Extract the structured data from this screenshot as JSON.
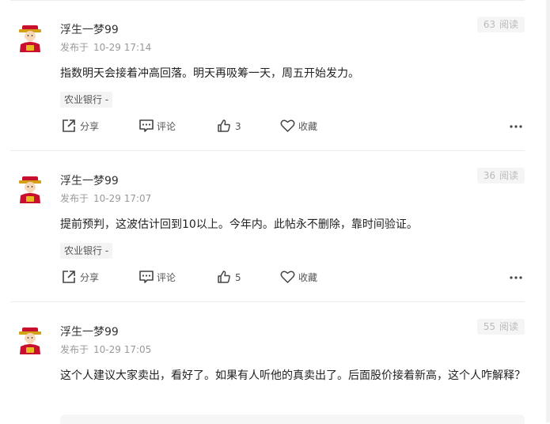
{
  "posts": [
    {
      "author": "浮生一梦99",
      "published_prefix": "发布于",
      "date": "10-29 17:14",
      "views_count": "63",
      "views_label": "阅读",
      "content": "指数明天会接着冲高回落。明天再吸筹一天，周五开始发力。",
      "tag": "农业银行 -",
      "share_label": "分享",
      "comment_label": "评论",
      "like_count": "3",
      "collect_label": "收藏"
    },
    {
      "author": "浮生一梦99",
      "published_prefix": "发布于",
      "date": "10-29 17:07",
      "views_count": "36",
      "views_label": "阅读",
      "content": "提前预判，这波估计回到10以上。今年内。此帖永不删除，靠时间验证。",
      "tag": "农业银行 -",
      "share_label": "分享",
      "comment_label": "评论",
      "like_count": "5",
      "collect_label": "收藏"
    },
    {
      "author": "浮生一梦99",
      "published_prefix": "发布于",
      "date": "10-29 17:05",
      "views_count": "55",
      "views_label": "阅读",
      "content": "这个人建议大家卖出，看好了。如果有人听他的真卖出了。后面股价接着新高，这个人咋解释？"
    }
  ],
  "icons": {
    "avatar": "caishen-avatar-icon",
    "share": "share-icon",
    "comment": "comment-icon",
    "like": "thumbs-up-icon",
    "collect": "heart-icon",
    "more": "more-dots-icon"
  }
}
